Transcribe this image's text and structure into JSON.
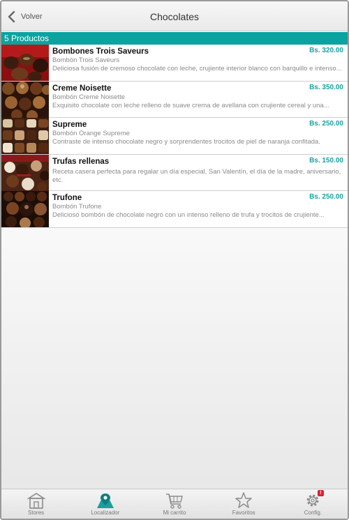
{
  "header": {
    "back_label": "Volver",
    "title": "Chocolates"
  },
  "count_label": "5 Productos",
  "products": [
    {
      "name": "Bombones Trois Saveurs",
      "subtitle": "Bombón Trois Saveurs",
      "description": "Deliciosa fusión de cremoso chocolate con leche, crujiente interior blanco con barquillo e intenso...",
      "price": "Bs. 320.00"
    },
    {
      "name": "Creme Noisette",
      "subtitle": "Bombón Creme Noisette",
      "description": "Exquisito chocolate con leche relleno de suave crema de avellana con crujiente cereal y una...",
      "price": "Bs. 350.00"
    },
    {
      "name": "Supreme",
      "subtitle": "Bombón Orange Supreme",
      "description": "Contraste de intenso chocolate negro y sorprendentes trocitos de piel de naranja confitada.",
      "price": "Bs. 250.00"
    },
    {
      "name": "Trufas rellenas",
      "subtitle": "",
      "description": "Receta casera perfecta para regalar un día especial, San Valentín, el día de la madre, aniversario, etc.",
      "price": "Bs. 150.00"
    },
    {
      "name": "Trufone",
      "subtitle": "Bombón Trufone",
      "description": "Delicioso bombón de chocolate negro con un intenso relleno de trufa y trocitos de crujiente...",
      "price": "Bs. 250.00"
    }
  ],
  "tabs": [
    {
      "label": "Stores",
      "icon": "store-icon"
    },
    {
      "label": "Localizador",
      "icon": "map-pin-icon"
    },
    {
      "label": "Mi carrito",
      "icon": "cart-icon"
    },
    {
      "label": "Favoritos",
      "icon": "star-icon"
    },
    {
      "label": "Config.",
      "icon": "gear-icon",
      "badge": "!"
    }
  ],
  "colors": {
    "accent": "#0aa3a0",
    "price": "#19a3a0",
    "badge": "#d9232e"
  }
}
